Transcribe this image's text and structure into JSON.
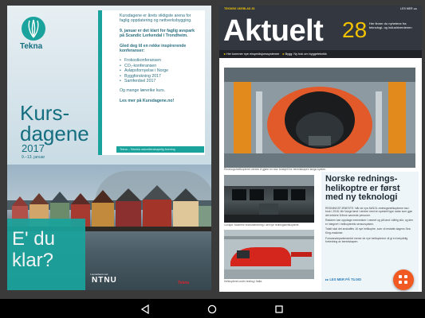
{
  "left_page": {
    "brand": "Tekna",
    "info_paragraph_1": "Kursdagene er årets viktigste arena for faglig oppdatering og nettverksbygging.",
    "info_paragraph_2": "9. januar er det klart for faglig avspark på Scandic Lerkendal i Trondheim.",
    "info_paragraph_3": "Gled deg til en rekke inspirerende konferanser:",
    "conferences": [
      "Frokostkonferansen",
      "CO₂-konferansen",
      "Avløpsfornyelse i Norge",
      "Byggforskning 2017",
      "Samferdsel 2017"
    ],
    "info_paragraph_4": "Og mange lærerike kurs.",
    "info_paragraph_5": "Les mer på Kursdagene.no!",
    "info_footer": "Tekna – Teknisk-naturvitenskapelig forening",
    "title": "Kurs-dagene",
    "year": "2017",
    "dates": "9.–13. januar",
    "tagline": "E' du klar?",
    "partner_small": "I samarbeid med",
    "partner_ntnu": "NTNU",
    "partner_other": "Tekna"
  },
  "right_page": {
    "header_meta_left": "TEKNISK UKEBLAD 28",
    "header_meta_right": "LES MER  ◂  ▸",
    "section_title": "Aktuelt",
    "issue_number": "28",
    "header_teaser": "Her finner du nyhetene fra teknologi- og industriverdenen",
    "ticker": [
      {
        "arrow": "▸",
        "text": "Her kommer nye ekspedisjonssystemer"
      },
      {
        "arrow": "▸",
        "text": "Bygg: Ny bok om byggeteknikk"
      }
    ],
    "main_caption": "Redningshelikopteret ventes å gjøre en stor forskjell for beredskapen langs kysten.",
    "cockpit_caption": "Cockpit: Moderne instrumentering i det nye redningshelikopteret.",
    "red_heli_caption": "Helikopteret under testing i Italia.",
    "headline": "Norske rednings-helikoptre er først med ny teknologi",
    "body_paragraphs": [
      "REDNINGSTJENESTE: Når de nye AW101-redningshelikoptrene tas i bruk i 2018, blir Norge først i verden med en spesiell type radar som gjør det enklere å finne savnede personer.",
      "Radaren kan oppdage mennesker i vannet og på land i dårlig sikt, og den er integrert i helikopterets sensorsystem.",
      "Totalt skal det anskaffes 16 nye helikoptre, som vil erstatte dagens Sea King-maskiner.",
      "Forsvarsdepartementet mener de nye helikoptrene vil gi en betydelig forbedring av beredskapen."
    ],
    "les_mer": "▸▸  LES MER PÅ TU.NO"
  },
  "nav": {
    "back": "back",
    "home": "home",
    "recents": "recents"
  },
  "colors": {
    "tekna_teal": "#1aa39c",
    "tekna_dark": "#156e80",
    "header_dark": "#333840",
    "accent_yellow": "#f2c100",
    "share_orange": "#f05a22"
  }
}
